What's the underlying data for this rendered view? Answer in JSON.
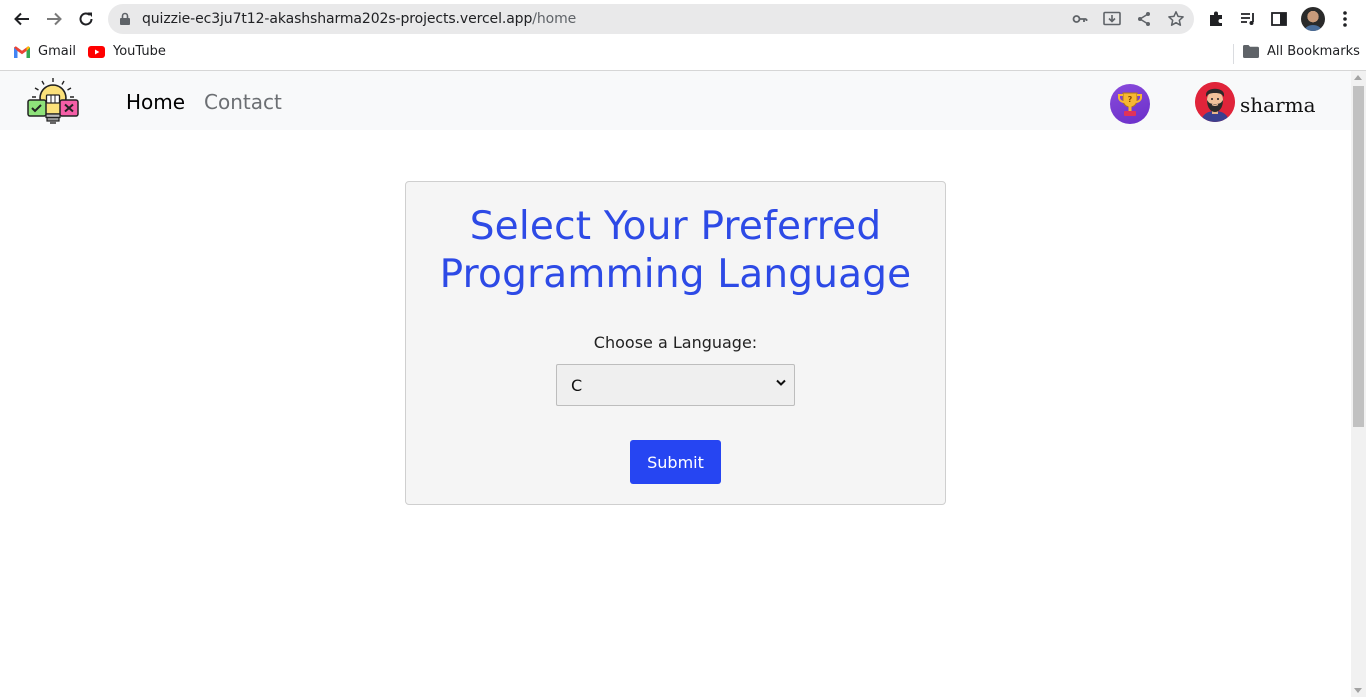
{
  "browser": {
    "url_host": "quizzie-ec3ju7t12-akashsharma202s-projects.vercel.app",
    "url_path": "/home",
    "bookmarks": [
      {
        "label": "Gmail",
        "icon": "gmail-icon"
      },
      {
        "label": "YouTube",
        "icon": "youtube-icon"
      }
    ],
    "all_bookmarks_label": "All Bookmarks"
  },
  "navbar": {
    "links": [
      {
        "label": "Home",
        "active": true
      },
      {
        "label": "Contact",
        "active": false
      }
    ],
    "username": "sharma"
  },
  "card": {
    "title_line1": "Select Your Preferred",
    "title_line2": "Programming Language",
    "label": "Choose a Language:",
    "selected_language": "C",
    "submit_label": "Submit"
  },
  "colors": {
    "accent": "#2d4ae6",
    "button": "#2645f2",
    "navbar_bg": "#f8f9fa",
    "card_bg": "#f5f5f5"
  }
}
